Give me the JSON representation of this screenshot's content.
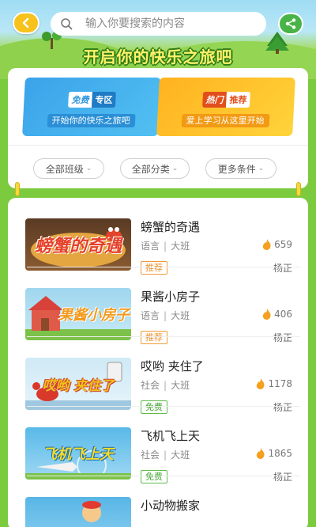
{
  "header": {
    "search_placeholder": "输入你要搜索的内容",
    "slogan": "开启你的快乐之旅吧"
  },
  "banners": [
    {
      "tag_a": "免费",
      "tag_b": "专区",
      "subtitle": "开始你的快乐之旅吧"
    },
    {
      "tag_a": "热门",
      "tag_b": "推荐",
      "subtitle": "爱上学习从这里开始"
    }
  ],
  "filters": [
    {
      "label": "全部班级"
    },
    {
      "label": "全部分类"
    },
    {
      "label": "更多条件"
    }
  ],
  "items": [
    {
      "title": "螃蟹的奇遇",
      "thumb_text": "螃蟹的奇遇",
      "subject": "语言",
      "grade": "大班",
      "count": "659",
      "badge": "推荐",
      "author": "杨正"
    },
    {
      "title": "果酱小房子",
      "thumb_text": "果酱小房子",
      "subject": "语言",
      "grade": "大班",
      "count": "406",
      "badge": "推荐",
      "author": "杨正"
    },
    {
      "title": "哎哟 夹住了",
      "thumb_text": "哎哟 夹住了",
      "subject": "社会",
      "grade": "大班",
      "count": "1178",
      "badge": "免费",
      "author": "杨正"
    },
    {
      "title": "飞机飞上天",
      "thumb_text": "飞机飞上天",
      "subject": "社会",
      "grade": "大班",
      "count": "1865",
      "badge": "免费",
      "author": "杨正"
    },
    {
      "title": "小动物搬家",
      "thumb_text": "",
      "subject": "",
      "grade": "",
      "count": "",
      "badge": "",
      "author": ""
    }
  ],
  "colors": {
    "background_green": "#7ccb3f",
    "back_button": "#f8c21c",
    "share_button": "#48b447",
    "recommend_badge": "#ef8c22",
    "free_badge": "#43a832"
  },
  "icons": [
    "chevron-left-icon",
    "search-icon",
    "share-icon",
    "flame-icon"
  ]
}
